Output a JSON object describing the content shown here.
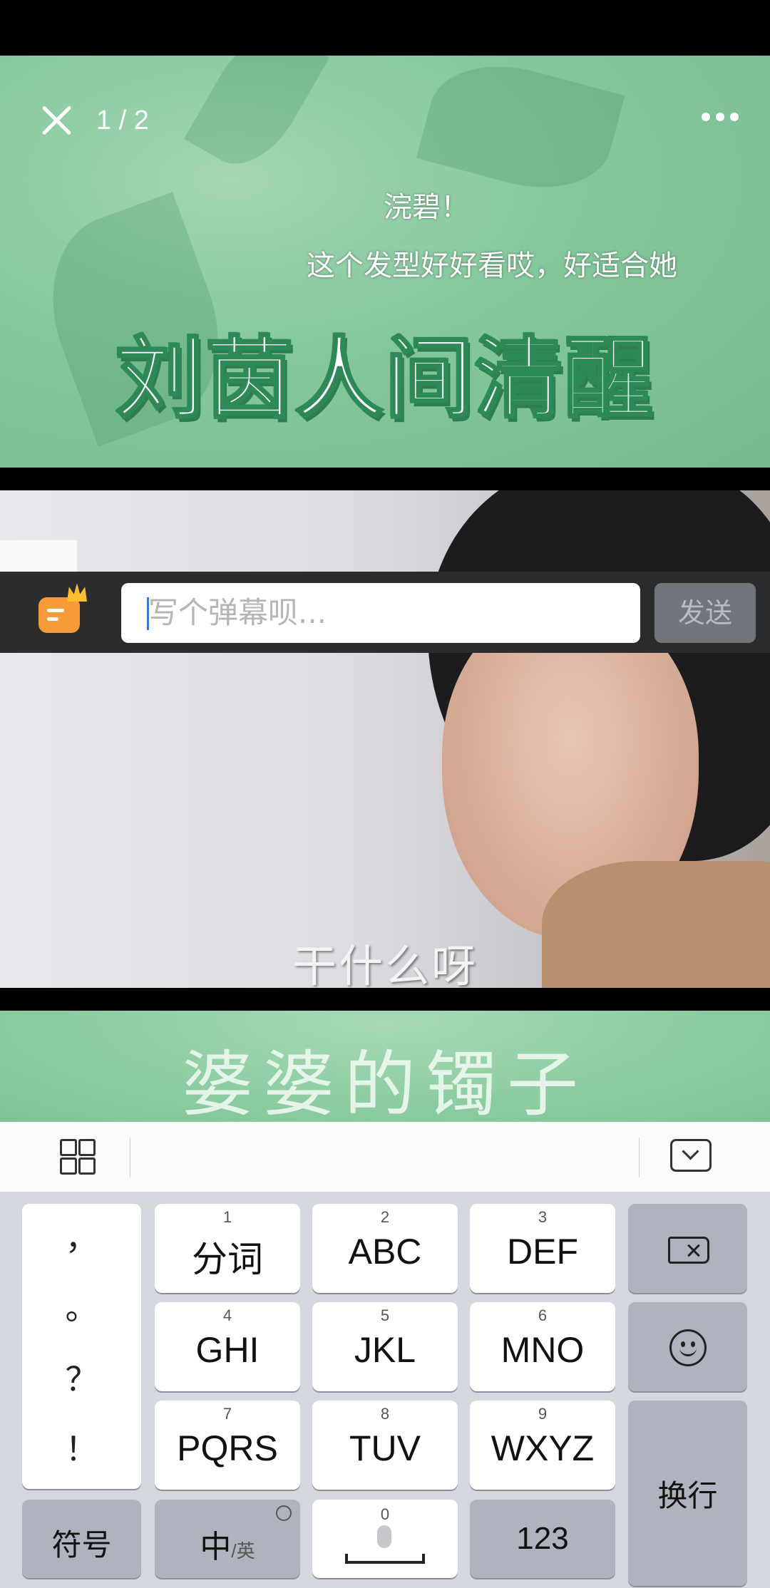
{
  "header": {
    "counter": "1 / 2"
  },
  "video": {
    "danmaku": [
      "浣碧！",
      "这个发型好好看哎，好适合她"
    ],
    "title_overlay": "刘茵人间清醒",
    "subtitle": "干什么呀",
    "bottom_overlay": "婆婆的镯子"
  },
  "comment_bar": {
    "placeholder": "写个弹幕呗...",
    "send_label": "发送"
  },
  "keyboard": {
    "punctuation": [
      "，",
      "。",
      "？",
      "！"
    ],
    "row1": [
      {
        "num": "1",
        "label": "分词"
      },
      {
        "num": "2",
        "label": "ABC"
      },
      {
        "num": "3",
        "label": "DEF"
      }
    ],
    "row2": [
      {
        "num": "4",
        "label": "GHI"
      },
      {
        "num": "5",
        "label": "JKL"
      },
      {
        "num": "6",
        "label": "MNO"
      }
    ],
    "row3": [
      {
        "num": "7",
        "label": "PQRS"
      },
      {
        "num": "8",
        "label": "TUV"
      },
      {
        "num": "9",
        "label": "WXYZ"
      }
    ],
    "enter_label": "换行",
    "symbol_label": "符号",
    "lang_main": "中",
    "lang_alt": "/英",
    "space_num": "0",
    "numbers_label": "123",
    "icons": [
      "grid-icon",
      "collapse-keyboard-icon",
      "backspace-icon",
      "emoji-icon",
      "globe-icon",
      "mic-icon"
    ]
  },
  "colors": {
    "send_bg": "#72757b",
    "accent_orange": "#f79a3a",
    "keyboard_bg": "#d4d7de",
    "caret": "#3a7bd5"
  }
}
